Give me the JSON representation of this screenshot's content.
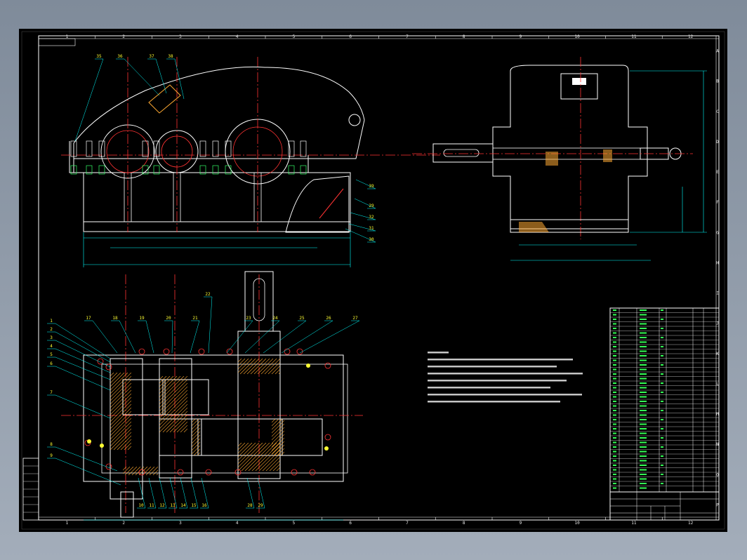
{
  "drawing": {
    "col_numbers": [
      "1",
      "2",
      "3",
      "4",
      "5",
      "6",
      "7",
      "8",
      "9",
      "10",
      "11",
      "12"
    ],
    "row_letters": [
      "A",
      "B",
      "C",
      "D",
      "E",
      "F",
      "G",
      "H",
      "I",
      "J",
      "K",
      "L",
      "M",
      "N",
      "O",
      "P"
    ],
    "front_view_callouts": [
      "35",
      "36",
      "37",
      "38",
      "39",
      "29",
      "32",
      "31",
      "30"
    ],
    "plan_view_callouts_left": [
      "1",
      "2",
      "3",
      "4",
      "5",
      "6",
      "7",
      "8",
      "9"
    ],
    "plan_view_callouts_top": [
      "17",
      "18",
      "19",
      "20",
      "21",
      "22",
      "23",
      "24",
      "25",
      "26",
      "27"
    ],
    "plan_view_callouts_bottom": [
      "10",
      "11",
      "12",
      "13",
      "14",
      "15",
      "16",
      "28",
      "29"
    ]
  },
  "colors": {
    "background": "#000000",
    "frame": "#ffffff",
    "centerline": "#ff3333",
    "dimension": "#00ffff",
    "callout": "#ffff33",
    "part": "#ffffff",
    "section_hatch": "#ffaa33",
    "bolt": "#33ff66"
  }
}
